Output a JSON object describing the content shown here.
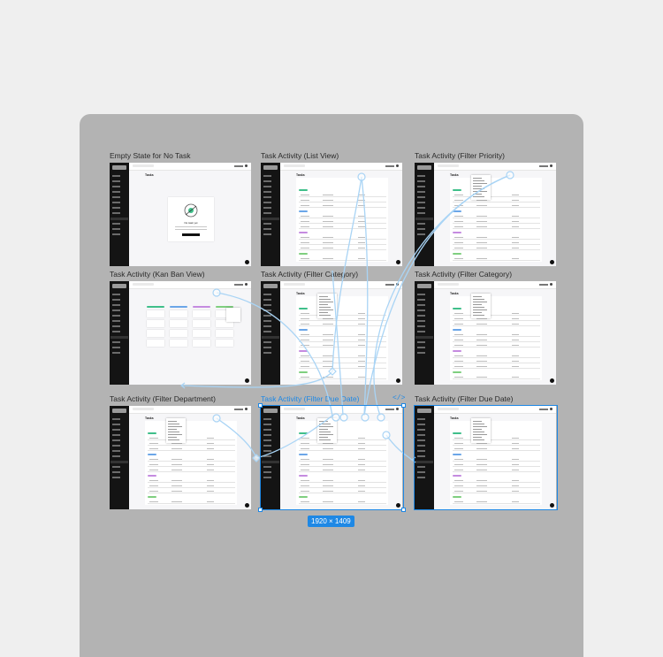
{
  "frames": [
    {
      "title": "Empty State for No Task",
      "heading": "Tasks",
      "variant": "empty",
      "empty_text": "No task yet"
    },
    {
      "title": "Task Activity (List View)",
      "heading": "Tasks",
      "variant": "list"
    },
    {
      "title": "Task Activity (Filter Priority)",
      "heading": "Tasks",
      "variant": "filter"
    },
    {
      "title": "Task Activity (Kan Ban View)",
      "heading": "",
      "variant": "kanban"
    },
    {
      "title": "Task Activity (Filter Category)",
      "heading": "Tasks",
      "variant": "filter"
    },
    {
      "title": "Task Activity (Filter Category)",
      "heading": "Tasks",
      "variant": "filter"
    },
    {
      "title": "Task Activity (Filter Department)",
      "heading": "Tasks",
      "variant": "filter"
    },
    {
      "title": "Task Activity (Filter Due Date)",
      "heading": "Tasks",
      "variant": "filter",
      "selected": true
    },
    {
      "title": "Task Activity (Filter Due Date)",
      "heading": "Tasks",
      "variant": "filter",
      "selected": true
    }
  ],
  "selection": {
    "dimensions": "1920 × 1409"
  },
  "icons": {
    "code": "code-icon"
  },
  "colors": {
    "accent": "#1e88e5",
    "connector": "#a9d4f5",
    "canvas": "#b3b3b3",
    "background": "#efefef",
    "sidebar": "#141414"
  },
  "tag_colors": [
    "#3fbf8a",
    "#6ba6e8",
    "#c58be0",
    "#7fcf7f"
  ]
}
